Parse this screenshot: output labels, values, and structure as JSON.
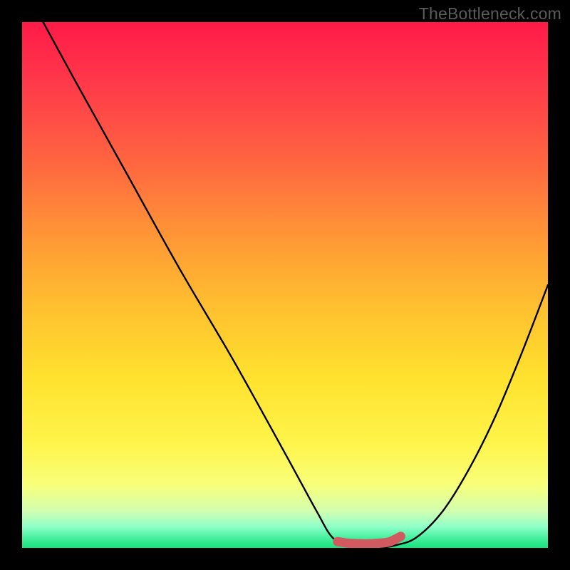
{
  "watermark": "TheBottleneck.com",
  "chart_data": {
    "type": "line",
    "title": "",
    "xlabel": "",
    "ylabel": "",
    "xlim": [
      0,
      100
    ],
    "ylim": [
      0,
      100
    ],
    "grid": false,
    "series": [
      {
        "name": "bottleneck-curve",
        "x": [
          4,
          10,
          20,
          30,
          40,
          50,
          56,
          59,
          62,
          65,
          68,
          71,
          75,
          80,
          85,
          90,
          95,
          100
        ],
        "y": [
          100,
          89,
          71,
          53,
          36,
          18,
          7,
          2,
          0.5,
          0,
          0,
          0.5,
          2,
          7,
          15,
          25,
          37,
          50
        ]
      }
    ],
    "marker": {
      "name": "optimal-range",
      "x": [
        60,
        62,
        64,
        66,
        68,
        70,
        72
      ],
      "y": [
        1.2,
        0.9,
        0.8,
        0.8,
        0.9,
        1.2,
        2.2
      ],
      "color": "#d05a5f",
      "end_dot_radius": 6
    },
    "gradient_stops": [
      {
        "pos": 0,
        "color": "#ff1a47"
      },
      {
        "pos": 12,
        "color": "#ff3a4a"
      },
      {
        "pos": 28,
        "color": "#ff6a3f"
      },
      {
        "pos": 42,
        "color": "#ff9b35"
      },
      {
        "pos": 55,
        "color": "#ffc22f"
      },
      {
        "pos": 68,
        "color": "#ffe22e"
      },
      {
        "pos": 80,
        "color": "#fff44a"
      },
      {
        "pos": 88,
        "color": "#f8ff7a"
      },
      {
        "pos": 93,
        "color": "#d2ffb0"
      },
      {
        "pos": 96,
        "color": "#8effc8"
      },
      {
        "pos": 98,
        "color": "#49f0a0"
      },
      {
        "pos": 100,
        "color": "#17e37c"
      }
    ]
  }
}
